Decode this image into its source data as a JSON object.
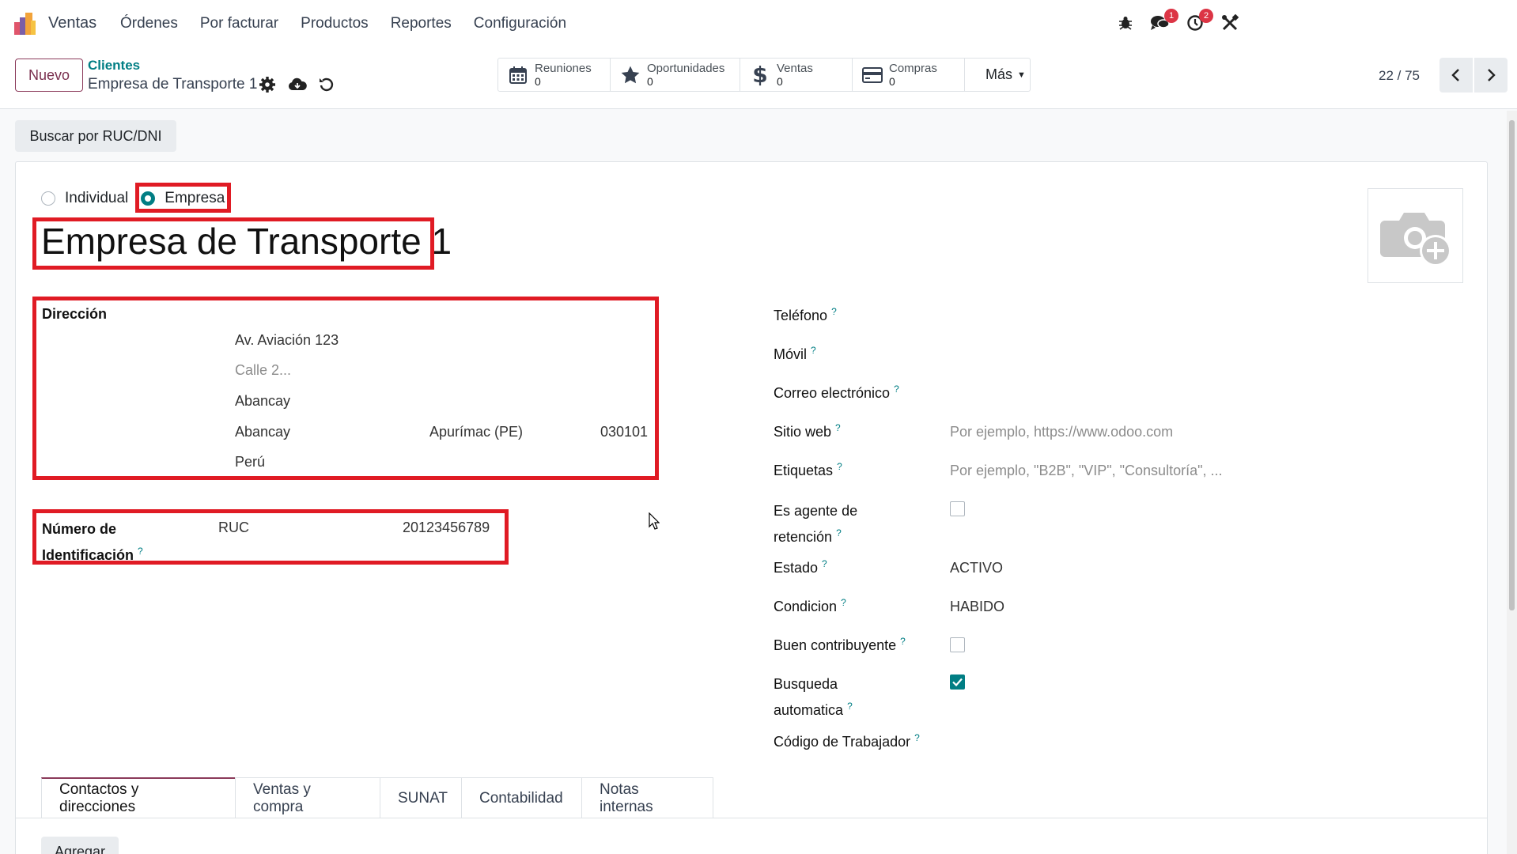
{
  "app": {
    "name": "Ventas"
  },
  "menu": [
    "Órdenes",
    "Por facturar",
    "Productos",
    "Reportes",
    "Configuración"
  ],
  "systray": {
    "messages_count": "1",
    "activities_count": "2"
  },
  "control": {
    "new_label": "Nuevo",
    "breadcrumb_parent": "Clientes",
    "breadcrumb_current": "Empresa de Transporte 1",
    "smart_buttons": [
      {
        "label": "Reuniones",
        "value": "0",
        "icon": "calendar-icon"
      },
      {
        "label": "Oportunidades",
        "value": "0",
        "icon": "star-icon"
      },
      {
        "label": "Ventas",
        "value": "0",
        "icon": "dollar-icon"
      },
      {
        "label": "Compras",
        "value": "0",
        "icon": "credit-card-icon"
      }
    ],
    "more_label": "Más",
    "pager": "22 / 75"
  },
  "form": {
    "search_ruc_label": "Buscar por RUC/DNI",
    "company_type": {
      "individual": "Individual",
      "company": "Empresa",
      "selected": "Empresa"
    },
    "name": "Empresa de Transporte 1",
    "address": {
      "label": "Dirección",
      "street": "Av. Aviación 123",
      "street2_placeholder": "Calle 2...",
      "district": "Abancay",
      "city": "Abancay",
      "state": "Apurímac (PE)",
      "zip": "030101",
      "country": "Perú"
    },
    "identification": {
      "label_line1": "Número de",
      "label_line2": "Identificación",
      "type": "RUC",
      "number": "20123456789"
    },
    "right": {
      "phone_label": "Teléfono",
      "mobile_label": "Móvil",
      "email_label": "Correo electrónico",
      "website_label": "Sitio web",
      "website_placeholder": "Por ejemplo, https://www.odoo.com",
      "tags_label": "Etiquetas",
      "tags_placeholder": "Por ejemplo, \"B2B\", \"VIP\", \"Consultoría\", ...",
      "retention_label_line1": "Es agente de",
      "retention_label_line2": "retención",
      "retention_checked": false,
      "status_label": "Estado",
      "status_value": "ACTIVO",
      "condition_label": "Condicion",
      "condition_value": "HABIDO",
      "good_taxpayer_label": "Buen contribuyente",
      "good_taxpayer_checked": false,
      "auto_search_label_line1": "Busqueda",
      "auto_search_label_line2": "automatica",
      "auto_search_checked": true,
      "worker_code_label": "Código de Trabajador"
    },
    "help_mark": "?",
    "tabs": [
      "Contactos y direcciones",
      "Ventas y compra",
      "SUNAT",
      "Contabilidad",
      "Notas internas"
    ],
    "add_label": "Agregar"
  }
}
